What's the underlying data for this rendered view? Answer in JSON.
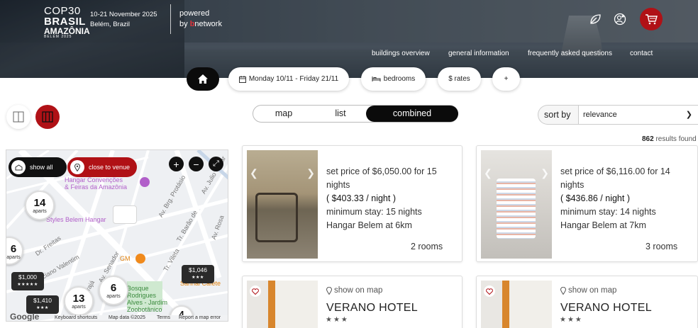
{
  "header": {
    "logo": {
      "line1": "COP30",
      "line2": "BRASIL",
      "line3": "AMAZÔNIA",
      "line4": "BELÉM 2025"
    },
    "dates": "10-21 November 2025",
    "city": "Belém, Brazil",
    "powered": "powered",
    "by": "by ",
    "brand_b": "b",
    "brand_rest": "network",
    "icons": [
      "leaf-icon",
      "user-settings-icon",
      "cart-icon"
    ],
    "nav": [
      "buildings overview",
      "general information",
      "frequently asked questions",
      "contact"
    ]
  },
  "filters": {
    "dates_label": "Monday 10/11 - Friday 21/11",
    "bedrooms_label": "bedrooms",
    "rates_label": "$ rates",
    "more_label": "+"
  },
  "view_mode": {
    "options": [
      "map",
      "list",
      "combined"
    ],
    "selected": "combined"
  },
  "sort": {
    "label": "sort by",
    "value": "relevance"
  },
  "results": {
    "count": "862",
    "suffix": " results found"
  },
  "map": {
    "show_all": "show all",
    "close_to_venue": "close to venue",
    "place_hangar": "Hangar Convenções",
    "place_hangar2": "& Feiras da Amazônia",
    "place_styles": "Styles Belem Hangar",
    "street1": "Av. Brg. Protásio",
    "street2": "Av. Julio César",
    "street3": "Tr. Barão de",
    "street4": "Av. Rosa",
    "street5": "Dr. Freitas",
    "street6": "Dr. Nilo",
    "street7": "Av. Senador",
    "street8": "Tr. Pirajá",
    "street9": "Tr. Vileta",
    "street10": "Luciano Valentim",
    "place_gm": "GM",
    "place_bosque1": "Bosque",
    "place_bosque2": "Rodrigues",
    "place_bosque3": "Alves - Jardim",
    "place_bosque4": "Zoobotânico",
    "place_sanhal": "Sanhal Cafete",
    "clusters": [
      {
        "n": "14",
        "u": "aparts"
      },
      {
        "n": "6",
        "u": "aparts"
      },
      {
        "n": "6",
        "u": "aparts"
      },
      {
        "n": "13",
        "u": "aparts"
      },
      {
        "n": "4",
        "u": ""
      }
    ],
    "prices": [
      {
        "price": "$1,046",
        "stars": "★★★"
      },
      {
        "price": "$1,000",
        "stars": "★★★★★"
      },
      {
        "price": "$1,410",
        "stars": "★★★"
      }
    ],
    "footer": {
      "google": "Google",
      "shortcuts": "Keyboard shortcuts",
      "mapdata": "Map data ©2025",
      "terms": "Terms",
      "report": "Report a map error"
    }
  },
  "cards": [
    {
      "l1": "set price of  $6,050.00 for 15",
      "l2": "nights",
      "l3": "( $403.33 / night )",
      "l4": "minimum stay: 15 nights",
      "l5": "Hangar Belem at 6km",
      "rooms": "2 rooms"
    },
    {
      "l1": "set price of  $6,116.00 for 14",
      "l2": "nights",
      "l3": "( $436.86 / night )",
      "l4": "minimum stay: 14 nights",
      "l5": "Hangar Belem at 7km",
      "rooms": "3 rooms"
    },
    {
      "show_on_map": "show on map",
      "name": "VERANO HOTEL",
      "stars": "★★★"
    },
    {
      "show_on_map": "show on map",
      "name": "VERANO HOTEL",
      "stars": "★★★"
    }
  ],
  "colors": {
    "accent_red": "#b01116",
    "dark": "#0b0b0b",
    "brand_b": "#e0323a"
  }
}
